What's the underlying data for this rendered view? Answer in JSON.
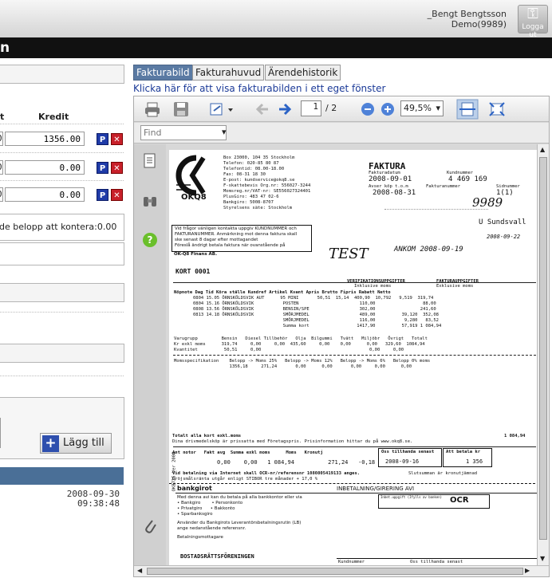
{
  "header": {
    "user_name": "_Bengt Bengtsson",
    "company": "Demo(9989)",
    "logout_label": "Logga ut"
  },
  "blackbar": {
    "title": "n"
  },
  "left": {
    "col_t": "t",
    "col_kredit": "Kredit",
    "rows": [
      {
        "left": "0",
        "kredit": "1356.00"
      },
      {
        "left": "0",
        "kredit": "0.00"
      },
      {
        "left": "0",
        "kredit": "0.00"
      }
    ],
    "p_label": "P",
    "x_label": "✕",
    "remaining_text": "de belopp att kontera:0.00",
    "add_label": "Lägg till",
    "date": "2008-09-30",
    "time": "09:38:48"
  },
  "tabs": [
    {
      "label": "Fakturabild"
    },
    {
      "label": "Fakturahuvud"
    },
    {
      "label": "Ärendehistorik"
    }
  ],
  "link_text": "Klicka här för att visa fakturabilden i ett eget fönster",
  "viewer": {
    "page": "1",
    "page_total": "/ 2",
    "zoom": "49,5%",
    "find_placeholder": "Find"
  },
  "invoice": {
    "sender": [
      "Box 23000, 104 35 Stockholm",
      "Telefon: 020-85 80 87",
      "Telefontid: 08.00-18.00",
      "Fax: 08-31 18 30",
      "E-post: kundservice@okq8.se",
      "F-skattebevis Org.nr: 556027-3244",
      "Momsreg.nr/VAT-nr: SE556027324401",
      "PlusGiro: 483 47 02-6",
      "Bankgiro: 5008-8707",
      "Styrelsens säte: Stockholm"
    ],
    "logo": "OKQ8",
    "title": "FAKTURA",
    "date_label": "Fakturadatum",
    "date": "2008-09-01",
    "cust_label": "Kundnummer",
    "cust": "4 469 169",
    "ref_label": "Avser köp t.o.m",
    "ref_date": "2008-08-31",
    "inv_label": "Fakturanummer",
    "page_label": "Sidnummer",
    "page": "1(1)",
    "notice": [
      "Vid frågor vänligen kontakta uppgiv KUNDNUMMER och",
      "FAKTURANUMMER. Anmärkning mot denna faktura skall",
      "ske senast 8 dagar efter mottagandet",
      "Föreslå ändrigt betala faktura när ovanstående på",
      "OK-Q8 Finans AB."
    ],
    "card": "KORT 0001",
    "hw_nr": "9989",
    "hw_city": "U Sundsvall",
    "hw_date": "2008-09-22",
    "hw_test": "TEST",
    "hw_ankom": "ANKOM 2008-09-19",
    "vhead1": "VERIFIKATIONSUPPGIFTER",
    "vhead2": "Inklusive moms",
    "fhead1": "FAKTURAUPPGIFTER",
    "fhead2": "Exklusive moms",
    "cols": [
      "Nöpnote",
      "Dag",
      "Tid",
      "Köra ställe",
      "Kundref",
      "Artikel",
      "Kvant",
      "Apris",
      "Brutto",
      "Fipris",
      "Rabatt",
      "Netto"
    ],
    "lines": [
      "0804 15.05 ÖRNSKÖLDSVIK AUT      95 MINI       50,51  15,14  400,90  10,792   9,519  319,74",
      "0804 15.16 ÖRNSKÖLDSVIK           POSTEN                       110,00                  88,00",
      "0808 13.56 ÖRNSKÖLDSVIK           BENSIN/SPE                   302,00                 241,60",
      "0813 14.18 ÖRNSKÖLDSVIK           SMÖRJMEDEL                   489,00          39,120  352,08",
      "                                  SMÖRJMEDEL                   116,00           9,280   83,52",
      "                                  Summa kort                  1417,90          57,919 1 084,94"
    ],
    "sum1": "Varugrupp         Bensin   Diesel Tillbehör   Olja  Bilgummi   Tvätt   Miljöbr   Övrigt   Totalt",
    "sum2": "Kr exkl moms      319,74     0,00     0,00  435,60     0,00    0,00      0,00   329,60  1084,94",
    "sum3": "Kvantitet          50,51     0,00                                         0,00     0,00",
    "moms1": "Momsspecifikation    Belopp -> Moms 25%   Belopp -> Moms 12%   Belopp -> Moms 6%   Belopp 0% moms",
    "moms2": "                     1356,18     271,24       0,00      0,00       0,00     0,00      0,00",
    "total_excl_label": "Totalt alla kort exkl.moms",
    "total_excl": "1 084,94",
    "prisinfo": "Dina drivmedelsköp är prissatta med Företagspris. Prisinformation hittar du på www.okq8.se.",
    "foot_cols": [
      "Ant notor",
      "Fakt avg",
      "Summa exkl moms",
      "Moms",
      "Kronutj",
      "Oss tillhanda senast",
      "Att betala kr"
    ],
    "foot_vals": [
      "0,00",
      "0,00",
      "1 084,94",
      "271,24",
      "-0,18",
      "2008-09-16",
      "1 356"
    ],
    "payment_note": "Vid betalning via Internet skall OCR-nr/referensnr 1080805419133 anges.",
    "payment_note2": "Dröjsmålsränta utgår enligt STIBOR tre månader + 17,0 %",
    "debt_label": "Slutsumman är kronutjämnad",
    "bg": "bankgirot",
    "bg_title": "INBETALNING/GIRERING   AVI",
    "bg_text": [
      "Med denna avi kan du betala på alla bankkontor eller via",
      "• Bankgiro        • Personkonto",
      "• Privatgiro      • Bakkonto",
      "• Sparbanksgiro",
      "Använder du Bankgirots Leverantörsbetalningsrutin (LB)",
      "ange nedanstående referensnr.",
      "Betalningsmottagare"
    ],
    "ocr": "OCR",
    "ocr_label": "Inbet.uppgift (Ifylls av banken)",
    "payee": "BOSTADSRÄTTSFÖRENINGEN",
    "kund_label": "Kundnummer",
    "oss_label": "Oss tillhanda senast",
    "side_code": "OKB725 Ver 2008"
  }
}
